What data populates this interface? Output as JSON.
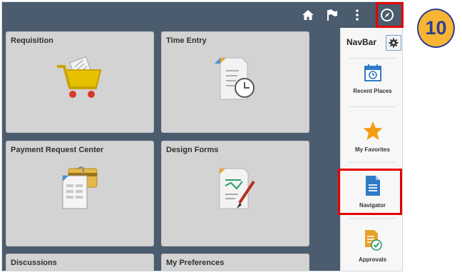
{
  "tiles": [
    {
      "title": "Requisition",
      "icon": "shopping-cart-icon"
    },
    {
      "title": "Time Entry",
      "icon": "timesheet-clock-icon"
    },
    {
      "title": "Payment Request Center",
      "icon": "payment-request-icon"
    },
    {
      "title": "Design Forms",
      "icon": "design-forms-icon"
    },
    {
      "title": "Discussions",
      "icon": ""
    },
    {
      "title": "My Preferences",
      "icon": ""
    }
  ],
  "navbar": {
    "title": "NavBar",
    "items": [
      {
        "label": "Recent Places",
        "icon": "calendar-clock-icon"
      },
      {
        "label": "My Favorites",
        "icon": "star-icon"
      },
      {
        "label": "Navigator",
        "icon": "document-icon"
      },
      {
        "label": "Approvals",
        "icon": "approvals-icon"
      }
    ]
  },
  "step_badge": "10",
  "colors": {
    "topbar": "#4a5c6d",
    "highlight": "#e50000",
    "badge_fill": "#f7b533",
    "badge_text": "#2d3f91"
  }
}
